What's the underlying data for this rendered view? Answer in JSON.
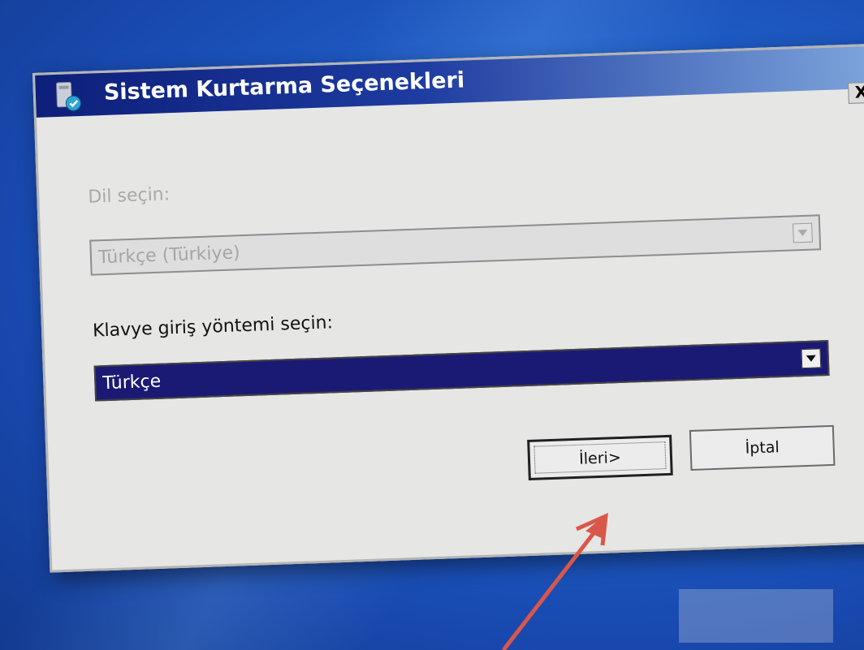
{
  "window": {
    "title": "Sistem Kurtarma Seçenekleri",
    "close_label": "X",
    "icon": "recovery-disk-icon"
  },
  "language": {
    "label": "Dil seçin:",
    "selected": "Türkçe (Türkiye)",
    "enabled": false
  },
  "keyboard": {
    "label": "Klavye giriş yöntemi seçin:",
    "selected": "Türkçe",
    "enabled": true
  },
  "buttons": {
    "next_label": "İleri>",
    "cancel_label": "İptal"
  },
  "annotation": {
    "arrow_color": "#d9574a",
    "points_to": "next-button"
  },
  "colors": {
    "title_bar": "#0d1f7a",
    "selection": "#1a1a74",
    "dialog_bg": "#e6e6e4"
  }
}
